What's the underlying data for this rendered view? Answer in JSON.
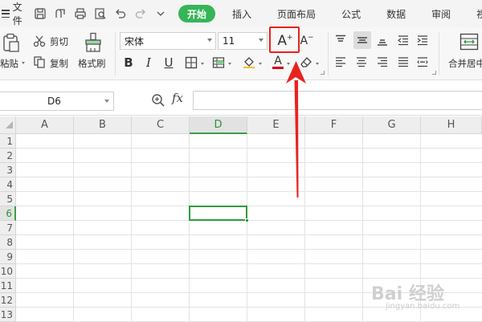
{
  "menu": {
    "file_label": "文件",
    "tabs": [
      "开始",
      "插入",
      "页面布局",
      "公式",
      "数据",
      "审阅",
      "视图"
    ],
    "active_tab": "开始"
  },
  "ribbon": {
    "paste_label": "粘贴",
    "cut_label": "剪切",
    "copy_label": "复制",
    "format_painter_label": "格式刷",
    "font_name": "宋体",
    "font_size": "11",
    "increase_font_glyph": "A",
    "decrease_font_glyph": "A",
    "bold_glyph": "B",
    "italic_glyph": "I",
    "underline_glyph": "U",
    "font_color_glyph": "A",
    "merge_center_label": "合并居中"
  },
  "formula_bar": {
    "name_box": "D6",
    "fx_label": "fx",
    "formula_value": ""
  },
  "grid": {
    "columns": [
      "A",
      "B",
      "C",
      "D",
      "E",
      "F",
      "G",
      "H"
    ],
    "rows": [
      "1",
      "2",
      "3",
      "4",
      "5",
      "6",
      "7",
      "8",
      "9",
      "10",
      "11",
      "12",
      "13"
    ],
    "selected_column": "D",
    "selected_row": "6"
  },
  "watermark": {
    "text": "Bai 经验",
    "subtext": "jingyan.baidu.com"
  },
  "colors": {
    "accent": "#35b558",
    "selection": "#2e9c3f",
    "annotation": "#e8231f"
  }
}
